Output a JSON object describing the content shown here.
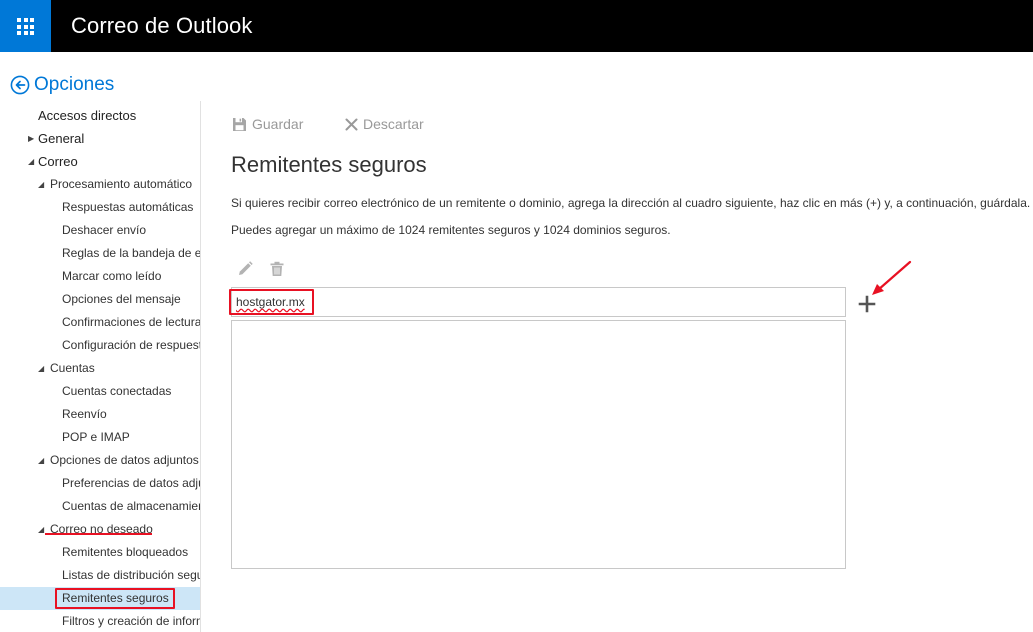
{
  "header": {
    "app_title": "Correo de Outlook",
    "launcher_icon": "app-launcher-waffle-icon",
    "accent_color": "#0078d7",
    "bar_color": "#000000"
  },
  "options_link": {
    "label": "Opciones",
    "icon": "back-arrow-circle-icon"
  },
  "sidebar": {
    "items": [
      {
        "label": "Accesos directos",
        "level": 0,
        "expander": ""
      },
      {
        "label": "General",
        "level": 0,
        "expander": "collapsed"
      },
      {
        "label": "Correo",
        "level": 0,
        "expander": "expanded"
      },
      {
        "label": "Procesamiento automático",
        "level": 1,
        "expander": "expanded"
      },
      {
        "label": "Respuestas automáticas",
        "level": 2,
        "expander": ""
      },
      {
        "label": "Deshacer envío",
        "level": 2,
        "expander": ""
      },
      {
        "label": "Reglas de la bandeja de en",
        "level": 2,
        "expander": ""
      },
      {
        "label": "Marcar como leído",
        "level": 2,
        "expander": ""
      },
      {
        "label": "Opciones del mensaje",
        "level": 2,
        "expander": ""
      },
      {
        "label": "Confirmaciones de lectura",
        "level": 2,
        "expander": ""
      },
      {
        "label": "Configuración de respuest",
        "level": 2,
        "expander": ""
      },
      {
        "label": "Cuentas",
        "level": 1,
        "expander": "expanded"
      },
      {
        "label": "Cuentas conectadas",
        "level": 2,
        "expander": ""
      },
      {
        "label": "Reenvío",
        "level": 2,
        "expander": ""
      },
      {
        "label": "POP e IMAP",
        "level": 2,
        "expander": ""
      },
      {
        "label": "Opciones de datos adjuntos",
        "level": 1,
        "expander": "expanded"
      },
      {
        "label": "Preferencias de datos adju",
        "level": 2,
        "expander": ""
      },
      {
        "label": "Cuentas de almacenamien",
        "level": 2,
        "expander": ""
      },
      {
        "label": "Correo no deseado",
        "level": 1,
        "expander": "expanded"
      },
      {
        "label": "Remitentes bloqueados",
        "level": 2,
        "expander": ""
      },
      {
        "label": "Listas de distribución segu",
        "level": 2,
        "expander": ""
      },
      {
        "label": "Remitentes seguros",
        "level": 2,
        "expander": "",
        "selected": true
      },
      {
        "label": "Filtros y creación de inform",
        "level": 2,
        "expander": ""
      }
    ],
    "selected_color": "#cde6f7"
  },
  "toolbar": {
    "save_label": "Guardar",
    "save_icon": "floppy-disk-icon",
    "discard_label": "Descartar",
    "discard_icon": "x-close-icon"
  },
  "main": {
    "title": "Remitentes seguros",
    "description_1": "Si quieres recibir correo electrónico de un remitente o dominio, agrega la dirección al cuadro siguiente, haz clic en más (+) y, a continuación, guárdala.",
    "description_2": "Puedes agregar un máximo de 1024 remitentes seguros y 1024 dominios seguros.",
    "edit_icon": "pencil-icon",
    "delete_icon": "trash-icon",
    "entry_value": "hostgator.mx",
    "add_icon": "plus-icon",
    "list_items": []
  },
  "annotations": {
    "highlight_color": "#e81123"
  }
}
